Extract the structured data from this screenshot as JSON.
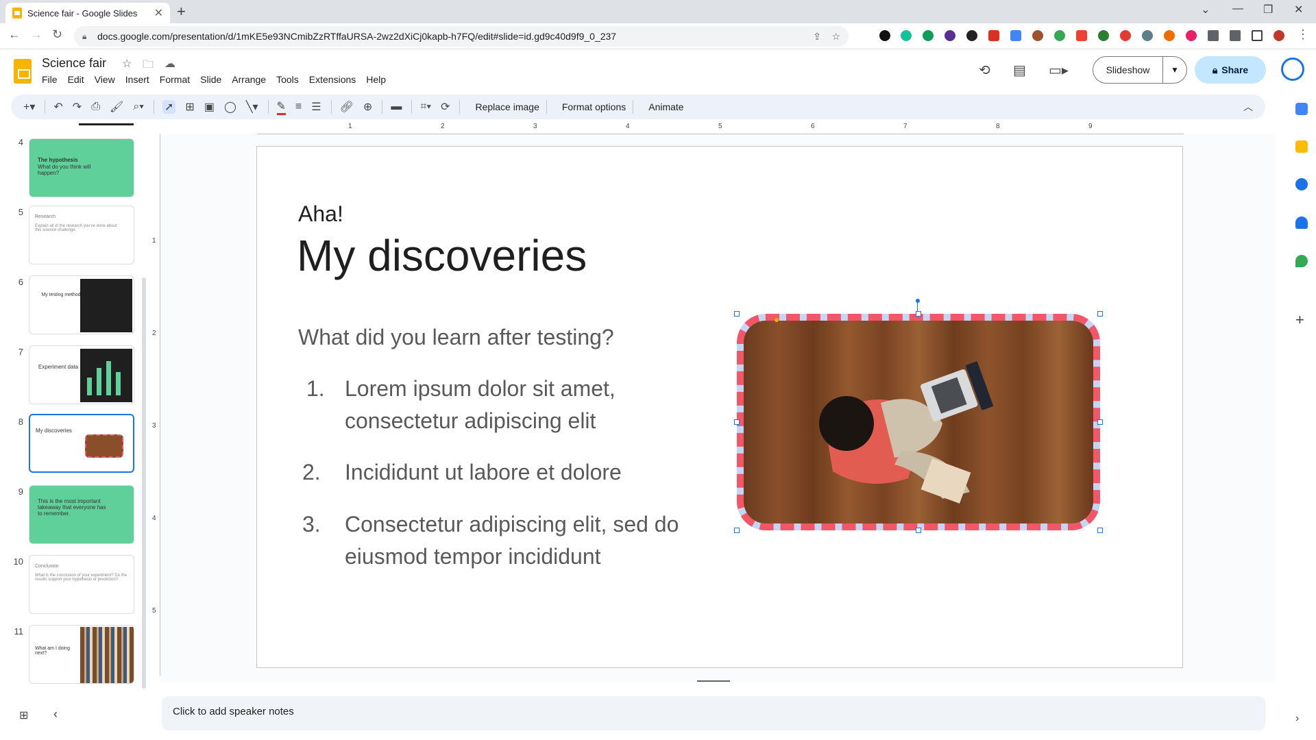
{
  "browser": {
    "tab_title": "Science fair - Google Slides",
    "url": "docs.google.com/presentation/d/1mKE5e93NCmibZzRTffaURSA-2wz2dXiCj0kapb-h7FQ/edit#slide=id.gd9c40d9f9_0_237"
  },
  "doc": {
    "title": "Science fair",
    "menu": [
      "File",
      "Edit",
      "View",
      "Insert",
      "Format",
      "Slide",
      "Arrange",
      "Tools",
      "Extensions",
      "Help"
    ],
    "slideshow_label": "Slideshow",
    "share_label": "Share"
  },
  "toolbar": {
    "replace_image": "Replace image",
    "format_options": "Format options",
    "animate": "Animate"
  },
  "filmstrip": [
    {
      "num": "4",
      "title": "The hypothesis",
      "body": "What do you think will happen?"
    },
    {
      "num": "5",
      "title": "Research",
      "body": "Explain all of the research you've done about this science challenge."
    },
    {
      "num": "6",
      "title": "My testing method",
      "body": ""
    },
    {
      "num": "7",
      "title": "Experiment data",
      "body": ""
    },
    {
      "num": "8",
      "title": "My discoveries",
      "body": ""
    },
    {
      "num": "9",
      "title": "This is the most important takeaway that everyone has to remember.",
      "body": ""
    },
    {
      "num": "10",
      "title": "Conclusion",
      "body": "What is the conclusion of your experiment? Do the results support your hypothesis or prediction?"
    },
    {
      "num": "11",
      "title": "What am I doing next?",
      "body": ""
    }
  ],
  "ruler": {
    "h": [
      "1",
      "2",
      "3",
      "4",
      "5",
      "6",
      "7",
      "8",
      "9"
    ],
    "v": [
      "1",
      "2",
      "3",
      "4",
      "5"
    ]
  },
  "slide": {
    "kicker": "Aha!",
    "heading": "My discoveries",
    "subhead": "What did you learn after testing?",
    "items": [
      {
        "n": "1.",
        "text": "Lorem ipsum dolor sit amet, consectetur adipiscing elit"
      },
      {
        "n": "2.",
        "text": "Incididunt ut labore et dolore"
      },
      {
        "n": "3.",
        "text": "Consectetur adipiscing elit, sed do eiusmod tempor incididunt"
      }
    ]
  },
  "notes_placeholder": "Click to add speaker notes",
  "colors": {
    "accent": "#1a73e8",
    "frame_red": "#f25768",
    "frame_blue": "#c5d5f5",
    "thumb_green": "#5fd09a"
  }
}
